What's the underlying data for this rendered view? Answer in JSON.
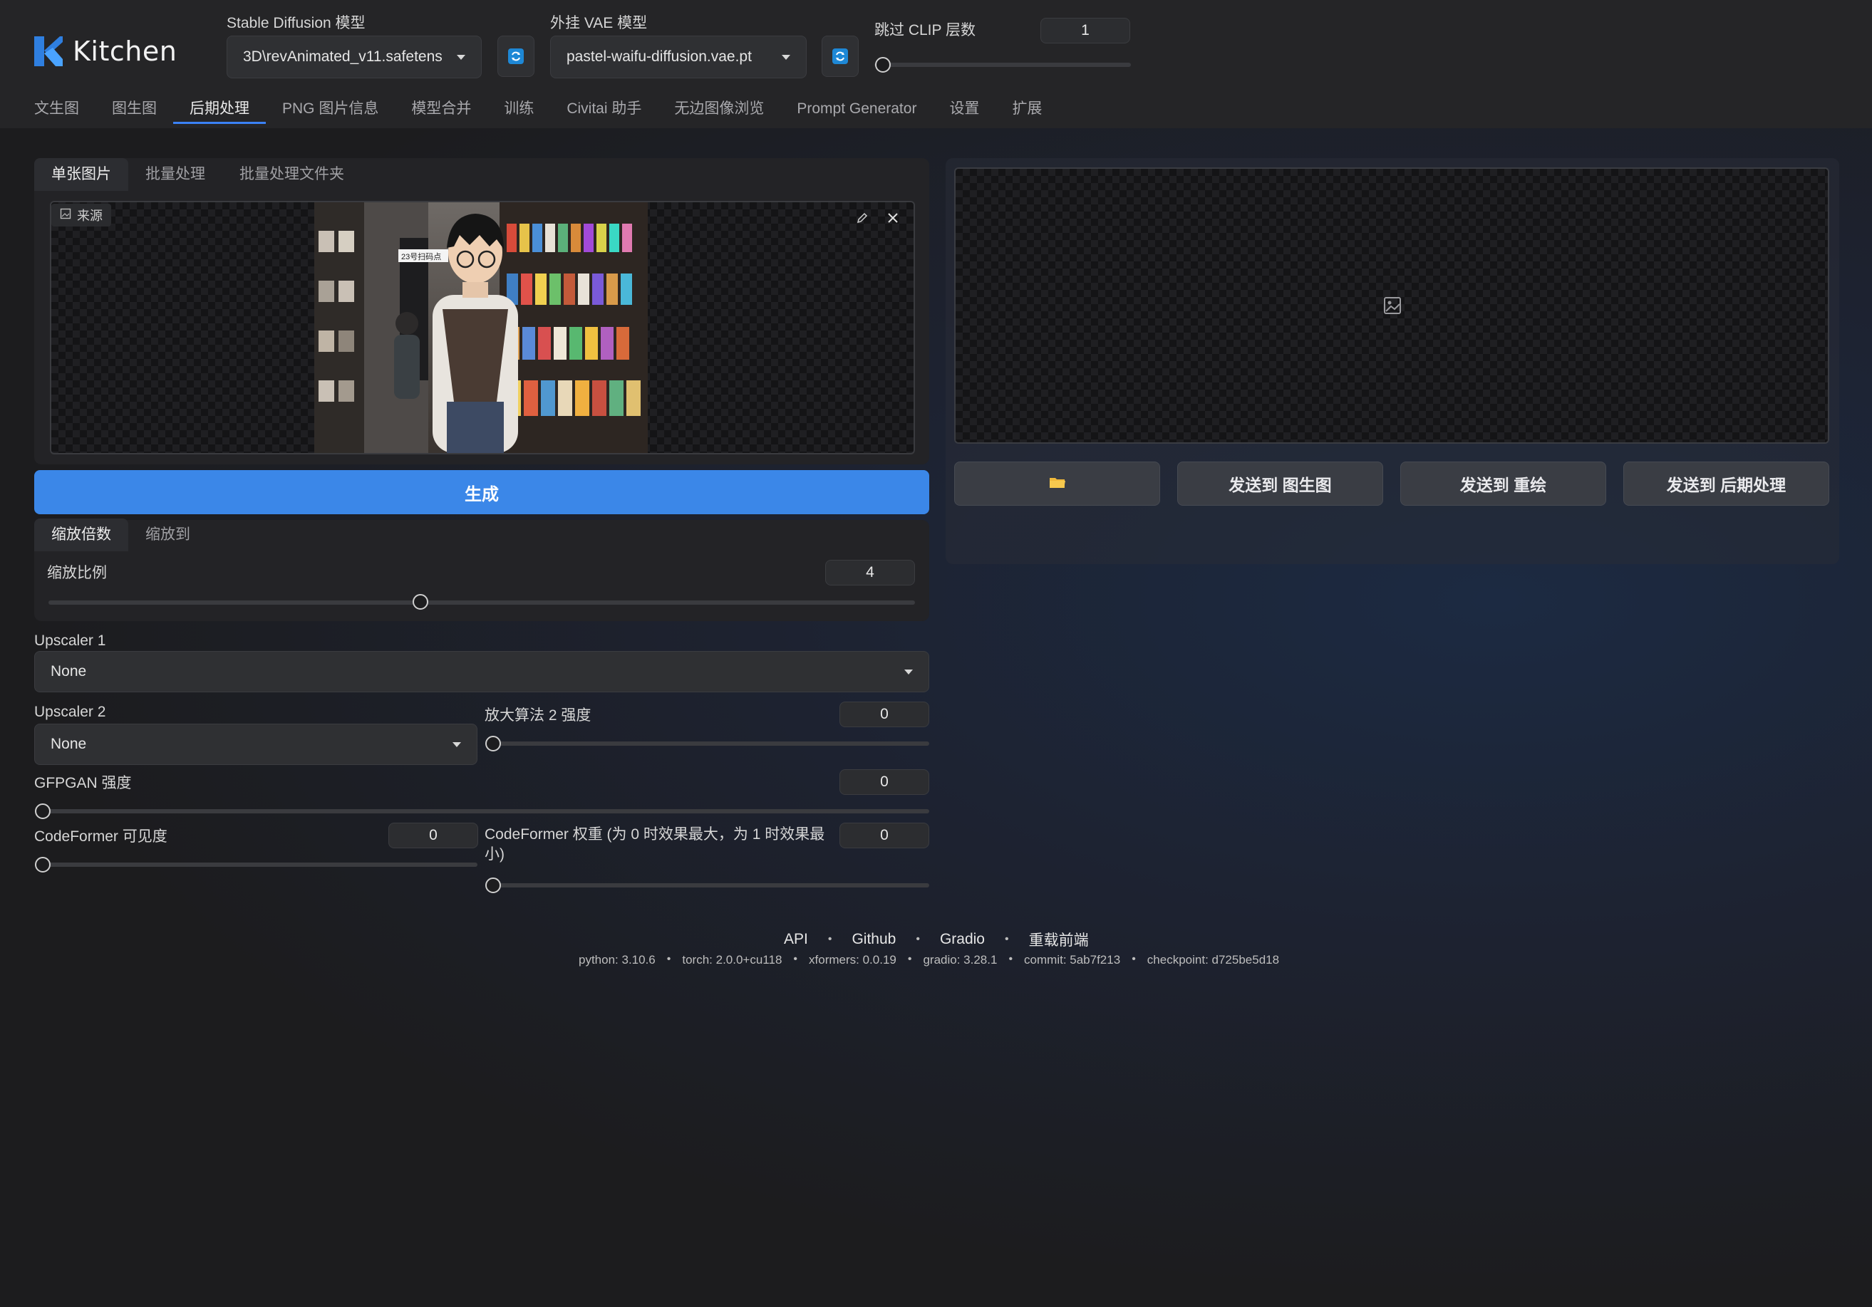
{
  "app": {
    "title": "Kitchen"
  },
  "header": {
    "sd_model": {
      "label": "Stable Diffusion 模型",
      "value": "3D\\revAnimated_v11.safetens"
    },
    "vae_model": {
      "label": "外挂 VAE 模型",
      "value": "pastel-waifu-diffusion.vae.pt"
    },
    "clip_skip": {
      "label": "跳过 CLIP 层数",
      "value": "1",
      "level": 0.0
    }
  },
  "tabs": [
    {
      "label": "文生图"
    },
    {
      "label": "图生图"
    },
    {
      "label": "后期处理",
      "active": true
    },
    {
      "label": "PNG 图片信息"
    },
    {
      "label": "模型合并"
    },
    {
      "label": "训练"
    },
    {
      "label": "Civitai 助手"
    },
    {
      "label": "无边图像浏览"
    },
    {
      "label": "Prompt Generator"
    },
    {
      "label": "设置"
    },
    {
      "label": "扩展"
    }
  ],
  "left": {
    "subtabs": [
      {
        "label": "单张图片",
        "active": true
      },
      {
        "label": "批量处理"
      },
      {
        "label": "批量处理文件夹"
      }
    ],
    "source_label": "来源",
    "image_sign": "23号扫码点",
    "generate_label": "生成",
    "resize_tabs": [
      {
        "label": "缩放倍数",
        "active": true
      },
      {
        "label": "缩放到"
      }
    ],
    "scale": {
      "label": "缩放比例",
      "value": "4",
      "level": 0.42
    },
    "upscaler1": {
      "label": "Upscaler 1",
      "value": "None"
    },
    "upscaler2": {
      "label": "Upscaler 2",
      "value": "None"
    },
    "upscaler2_strength": {
      "label": "放大算法 2 强度",
      "value": "0",
      "level": 0.0
    },
    "gfpgan": {
      "label": "GFPGAN 强度",
      "value": "0",
      "level": 0.0
    },
    "codeformer_vis": {
      "label": "CodeFormer 可见度",
      "value": "0",
      "level": 0.0
    },
    "codeformer_weight": {
      "label": "CodeFormer 权重 (为 0 时效果最大，为 1 时效果最小)",
      "value": "0",
      "level": 0.0
    }
  },
  "right": {
    "buttons": [
      {
        "label": ""
      },
      {
        "label": "发送到 图生图"
      },
      {
        "label": "发送到 重绘"
      },
      {
        "label": "发送到 后期处理"
      }
    ]
  },
  "footer": {
    "links": [
      "API",
      "Github",
      "Gradio",
      "重载前端"
    ],
    "versions": [
      "python: 3.10.6",
      "torch: 2.0.0+cu118",
      "xformers: 0.0.19",
      "gradio: 3.28.1",
      "commit: 5ab7f213",
      "checkpoint: d725be5d18"
    ]
  },
  "colors": {
    "accent": "#3b87e8",
    "folder": "#f0b93b",
    "refresh": "#1e88d6"
  }
}
